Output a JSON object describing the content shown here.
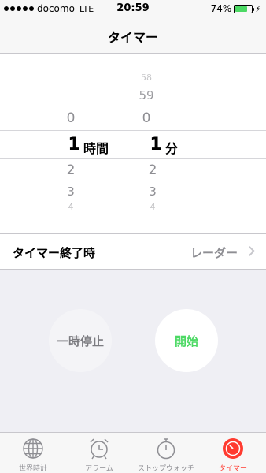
{
  "status_bar": {
    "carrier": "docomo",
    "network": "LTE",
    "time": "20:59",
    "battery_percent": "74%",
    "battery_level": 0.74,
    "charging_icon": "bolt-icon"
  },
  "nav": {
    "title": "タイマー"
  },
  "picker": {
    "hours": {
      "above": [
        "0"
      ],
      "selected": "1",
      "below": [
        "2",
        "3",
        "4"
      ],
      "unit": "時間"
    },
    "minutes": {
      "above": [
        "58",
        "59",
        "0"
      ],
      "selected": "1",
      "below": [
        "2",
        "3",
        "4"
      ],
      "unit": "分"
    }
  },
  "sound": {
    "label": "タイマー終了時",
    "value": "レーダー"
  },
  "buttons": {
    "pause": "一時停止",
    "start": "開始"
  },
  "tabs": [
    {
      "label": "世界時計",
      "icon": "globe-icon"
    },
    {
      "label": "アラーム",
      "icon": "alarm-clock-icon"
    },
    {
      "label": "ストップウォッチ",
      "icon": "stopwatch-icon"
    },
    {
      "label": "タイマー",
      "icon": "timer-icon",
      "active": true
    }
  ],
  "colors": {
    "accent": "#ff3b30",
    "start": "#4cd964",
    "battery": "#4cd964"
  }
}
